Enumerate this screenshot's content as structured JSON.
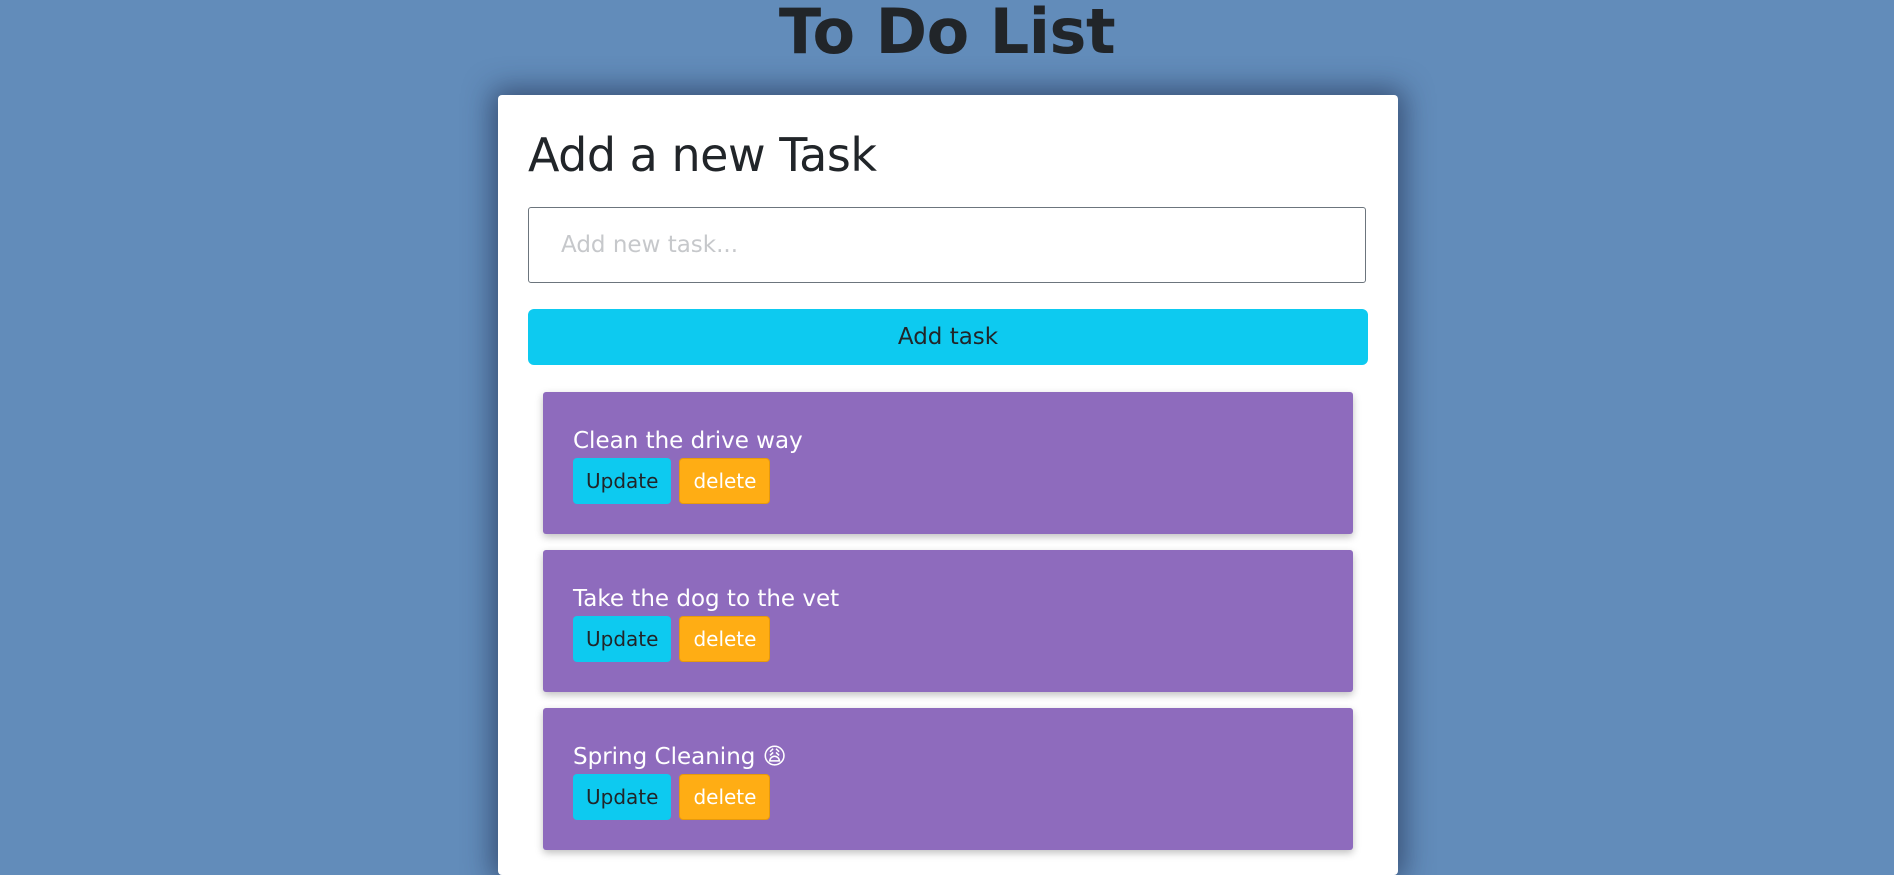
{
  "page": {
    "title": "To Do List"
  },
  "form": {
    "heading": "Add a new Task",
    "input_placeholder": "Add new task...",
    "input_value": "",
    "add_button_label": "Add task"
  },
  "tasks": [
    {
      "text": "Clean the drive way",
      "update_label": "Update",
      "delete_label": "delete"
    },
    {
      "text": "Take the dog to the vet",
      "update_label": "Update",
      "delete_label": "delete"
    },
    {
      "text": "Spring Cleaning 😩",
      "update_label": "Update",
      "delete_label": "delete"
    }
  ],
  "colors": {
    "background": "#628cba",
    "card": "#ffffff",
    "task_item": "#8e6bbd",
    "primary_button": "#0dcaf0",
    "delete_button": "#ffad14",
    "text_dark": "#212529"
  }
}
